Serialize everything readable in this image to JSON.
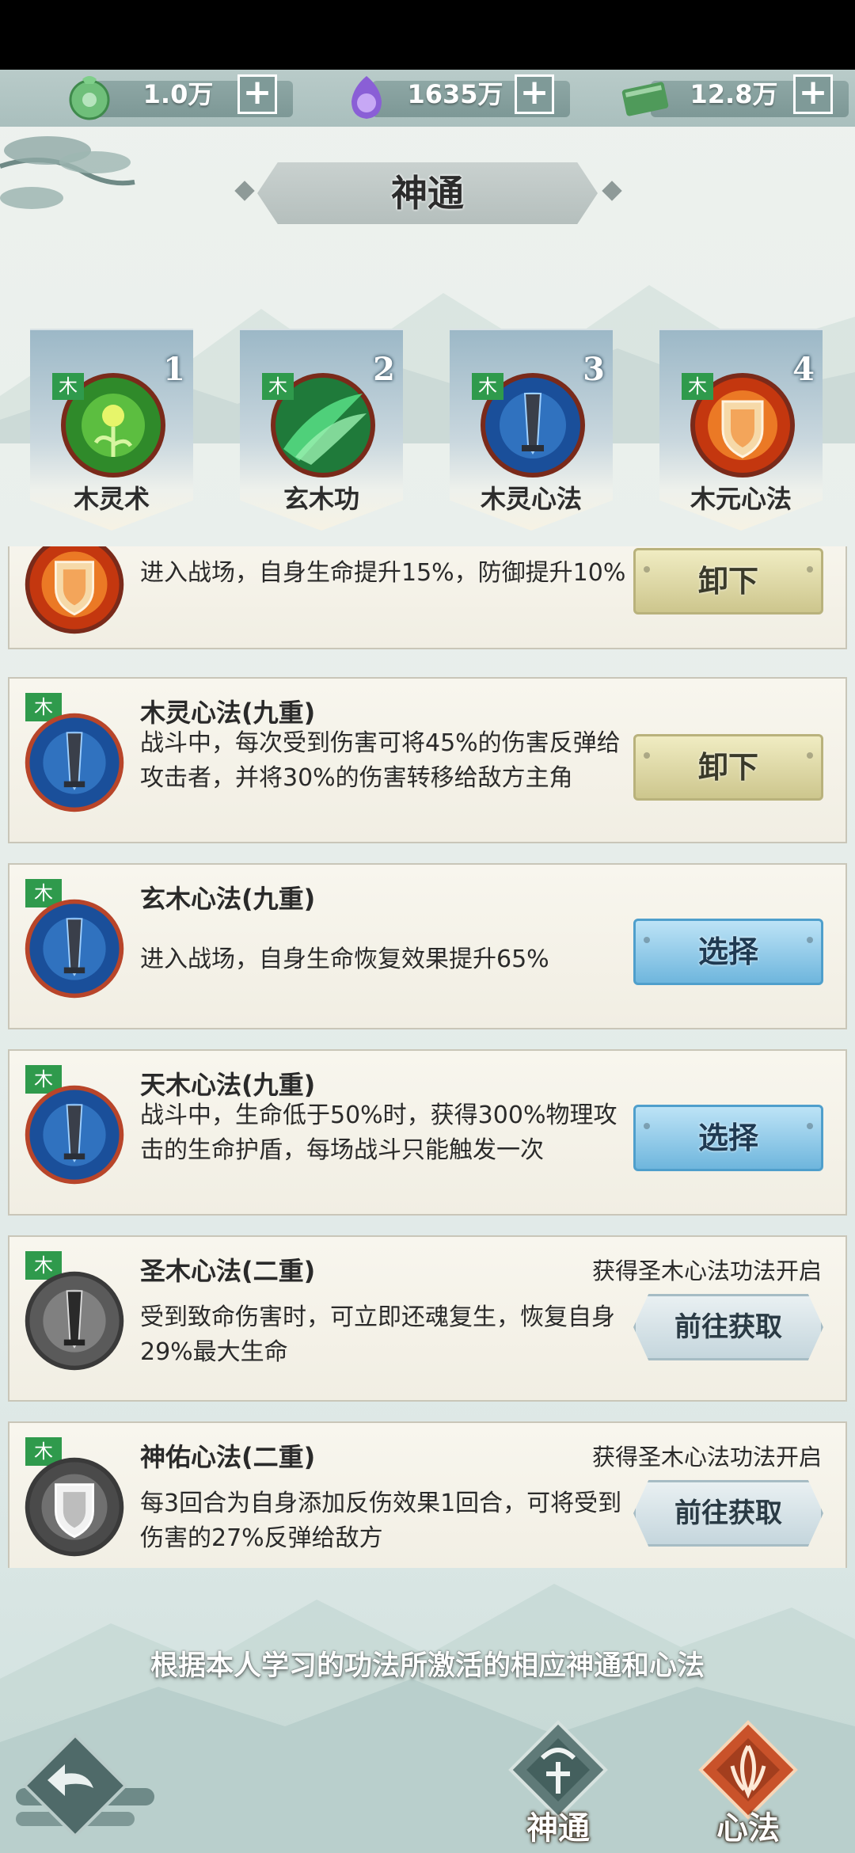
{
  "resources": [
    {
      "icon": "jade-coin-icon",
      "value": "1.0万"
    },
    {
      "icon": "purple-spirit-icon",
      "value": "1635万"
    },
    {
      "icon": "green-scroll-icon",
      "value": "12.8万"
    }
  ],
  "title": "神通",
  "element_tag": "木",
  "tabs": [
    {
      "num": "1",
      "label": "木灵术"
    },
    {
      "num": "2",
      "label": "玄木功"
    },
    {
      "num": "3",
      "label": "木灵心法"
    },
    {
      "num": "4",
      "label": "木元心法"
    }
  ],
  "cards": [
    {
      "name": "",
      "desc": "进入战场，自身生命提升15%，防御提升10%",
      "button": "卸下",
      "condition": ""
    },
    {
      "name": "木灵心法(九重)",
      "desc": "战斗中，每次受到伤害可将45%的伤害反弹给攻击者，并将30%的伤害转移给敌方主角",
      "button": "卸下",
      "condition": ""
    },
    {
      "name": "玄木心法(九重)",
      "desc": "进入战场，自身生命恢复效果提升65%",
      "button": "选择",
      "condition": ""
    },
    {
      "name": "天木心法(九重)",
      "desc": "战斗中，生命低于50%时，获得300%物理攻击的生命护盾，每场战斗只能触发一次",
      "button": "选择",
      "condition": ""
    },
    {
      "name": "圣木心法(二重)",
      "desc": "受到致命伤害时，可立即还魂复生，恢复自身29%最大生命",
      "button": "前往获取",
      "condition": "获得圣木心法功法开启"
    },
    {
      "name": "神佑心法(二重)",
      "desc": "每3回合为自身添加反伤效果1回合，可将受到伤害的27%反弹给敌方",
      "button": "前往获取",
      "condition": "获得圣木心法功法开启"
    }
  ],
  "footer_text": "根据本人学习的功法所激活的相应神通和心法",
  "nav": {
    "shentong": "神通",
    "xinfa": "心法"
  },
  "colors": {
    "wood_tag": "#2f9a4c",
    "unload_btn": "#cdc68d",
    "select_btn": "#6fb6dd"
  }
}
